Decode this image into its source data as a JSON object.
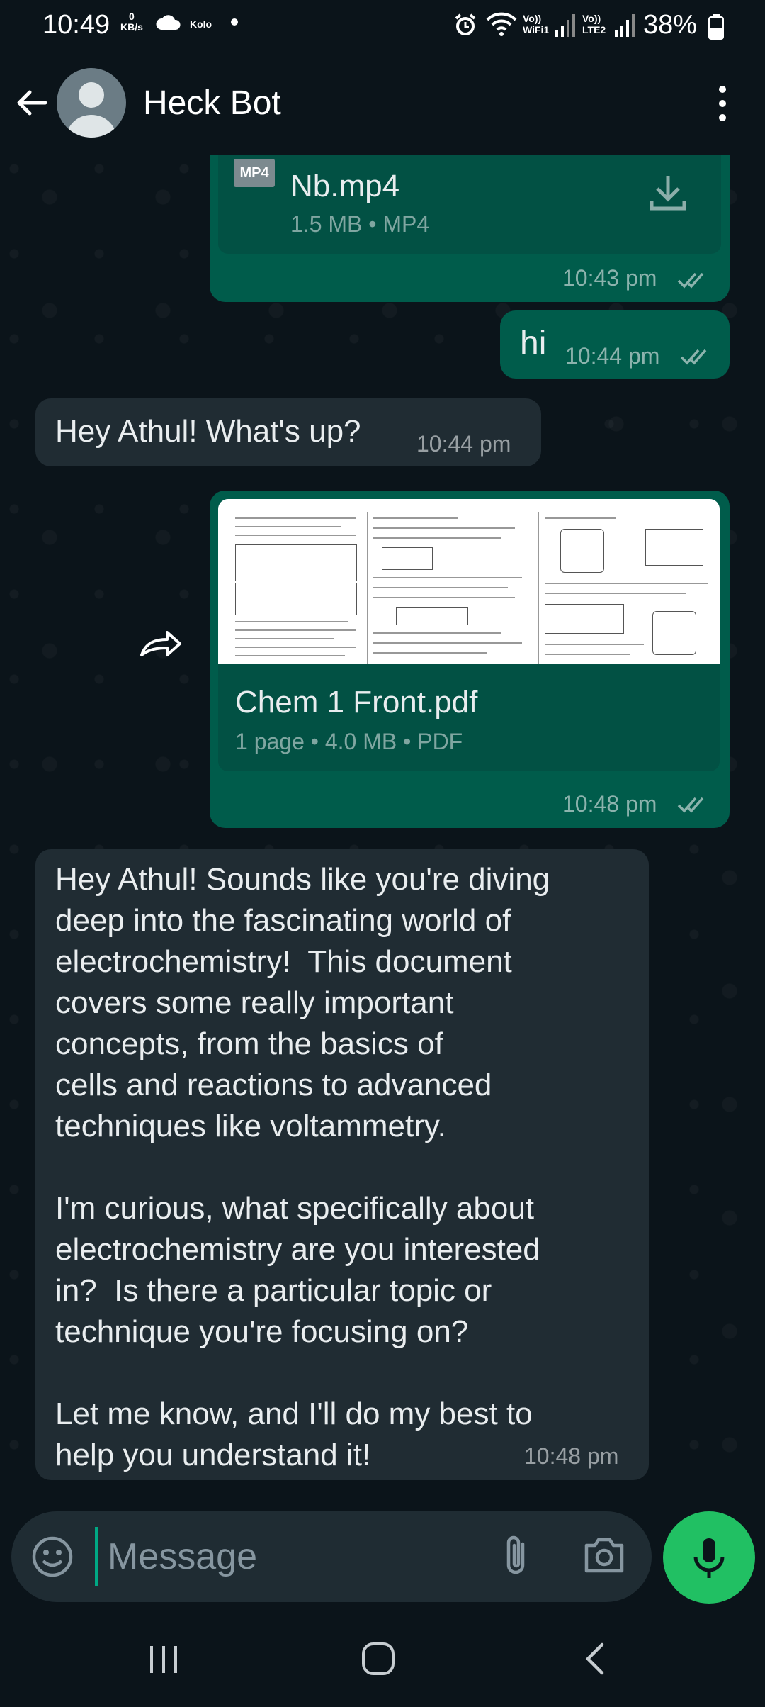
{
  "status_bar": {
    "time": "10:49",
    "net_speed_value": "0",
    "net_speed_unit": "KB/s",
    "app_label": "Kolo",
    "volte1": "Vo)) WiFi1",
    "volte2": "Vo)) LTE2",
    "battery": "38%"
  },
  "header": {
    "back_icon": "arrow-left-icon",
    "avatar_icon": "person-avatar-icon",
    "title": "Heck Bot",
    "menu_icon": "more-vertical-icon"
  },
  "messages": [
    {
      "direction": "outgoing",
      "type": "file",
      "file_badge": "MP4",
      "file_name": "Nb.mp4",
      "file_meta": "1.5 MB • MP4",
      "action_icon": "download-icon",
      "time": "10:43 pm",
      "status": "read"
    },
    {
      "direction": "outgoing",
      "type": "text",
      "text": "hi",
      "time": "10:44 pm",
      "status": "read"
    },
    {
      "direction": "incoming",
      "type": "text",
      "text": "Hey Athul! What's up?",
      "time": "10:44 pm"
    },
    {
      "direction": "outgoing",
      "type": "document",
      "forwarded": true,
      "file_name": "Chem 1 Front.pdf",
      "file_meta": "1 page • 4.0 MB • PDF",
      "time": "10:48 pm",
      "status": "read"
    },
    {
      "direction": "incoming",
      "type": "text",
      "text": "Hey Athul! Sounds like you're diving\ndeep into the fascinating world of\nelectrochemistry!  This document\ncovers some really important\nconcepts, from the basics of\ncells and reactions to advanced\ntechniques like voltammetry.\n\nI'm curious, what specifically about\nelectrochemistry are you interested\nin?  Is there a particular topic or\ntechnique you're focusing on?\n\nLet me know, and I'll do my best to\nhelp you understand it!",
      "time": "10:48 pm"
    }
  ],
  "composer": {
    "placeholder": "Message",
    "emoji_icon": "emoji-icon",
    "attach_icon": "paperclip-icon",
    "camera_icon": "camera-icon",
    "mic_icon": "microphone-icon"
  },
  "colors": {
    "background": "#0b141a",
    "outgoing_bubble": "#005c4b",
    "incoming_bubble": "#202c33",
    "accent": "#21c063"
  }
}
